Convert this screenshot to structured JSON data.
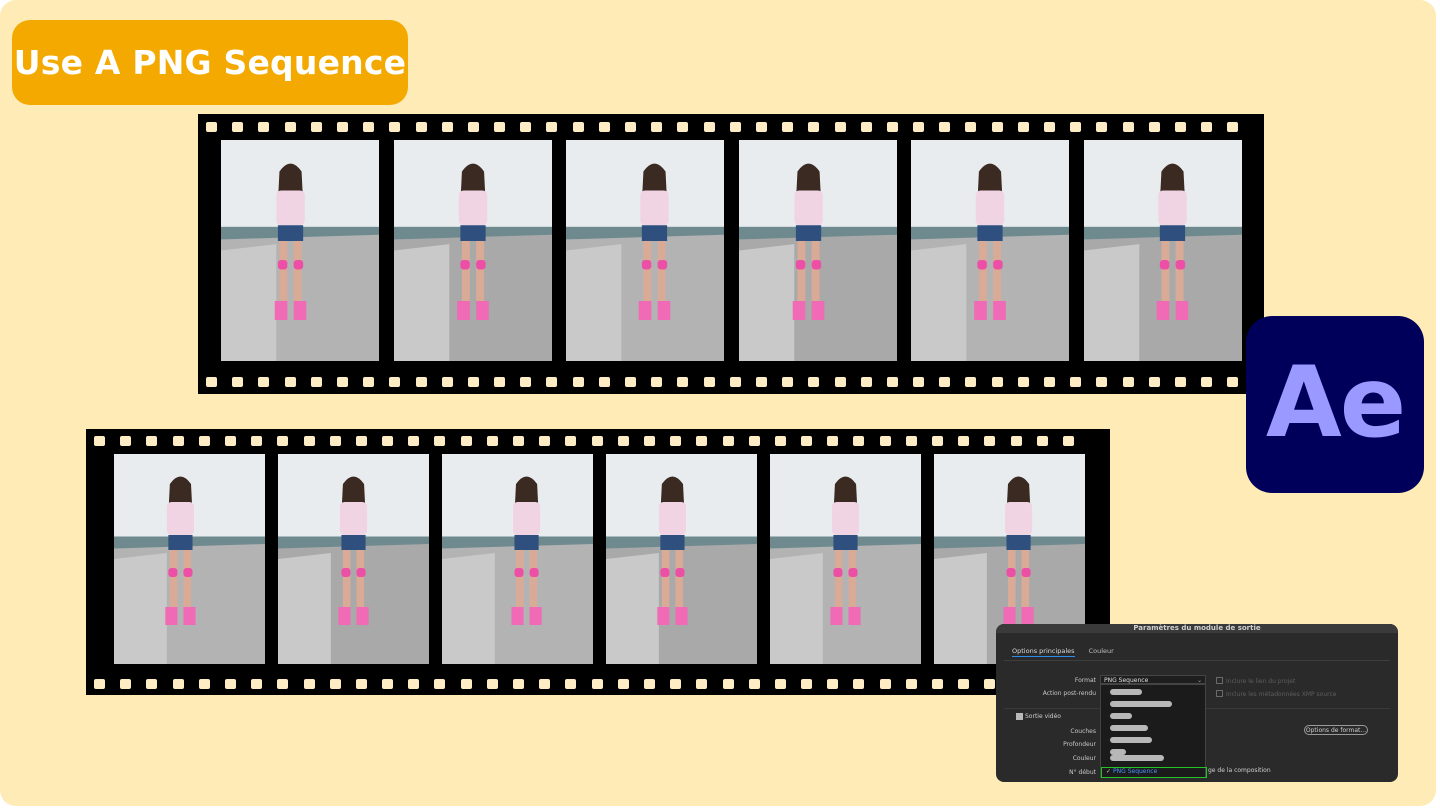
{
  "title": "Use A PNG Sequence",
  "logo": {
    "text": "Ae",
    "bg": "#00005b",
    "fg": "#9999ff"
  },
  "colors": {
    "background": "#feebb5",
    "badge": "#f3a900",
    "film": "#000000"
  },
  "dialog": {
    "title": "Paramètres du module de sortie",
    "tabs": [
      "Options principales",
      "Couleur"
    ],
    "format_label": "Format",
    "format_value": "PNG Sequence",
    "post_render_label": "Action post-rendu",
    "include_project_link": "Inclure le lien du projet",
    "include_xmp": "Inclure les métadonnées XMP source",
    "video_output_label": "Sortie vidéo",
    "layers_label": "Couches",
    "depth_label": "Profondeur",
    "color_label": "Couleur",
    "start_label": "N° début",
    "format_options_button": "Options de format...",
    "selected_item": "PNG Sequence",
    "tail_text": "ge de la composition"
  }
}
